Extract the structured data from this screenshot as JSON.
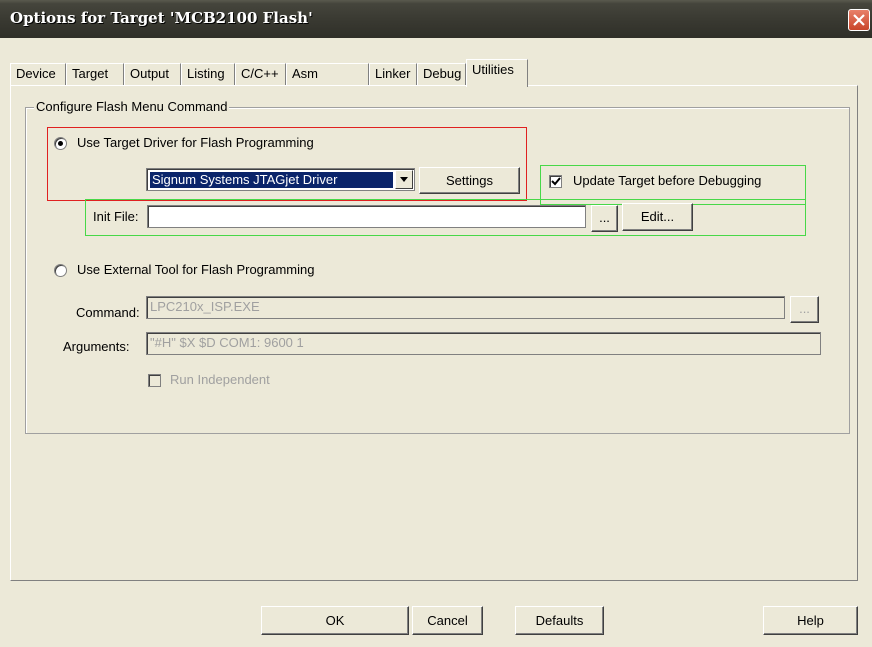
{
  "window": {
    "title": "Options for Target 'MCB2100 Flash'"
  },
  "tabs": [
    {
      "label": "Device"
    },
    {
      "label": "Target"
    },
    {
      "label": "Output"
    },
    {
      "label": "Listing"
    },
    {
      "label": "C/C++"
    },
    {
      "label": "Asm"
    },
    {
      "label": "Linker"
    },
    {
      "label": "Debug"
    },
    {
      "label": "Utilities",
      "active": true
    }
  ],
  "group": {
    "legend": "Configure Flash Menu Command",
    "use_target_driver": {
      "label": "Use Target Driver for Flash Programming",
      "selected": true
    },
    "driver_select": {
      "value": "Signum Systems JTAGjet Driver"
    },
    "settings_button": "Settings",
    "update_target": {
      "label": "Update Target before Debugging",
      "checked": true
    },
    "init_file": {
      "label": "Init File:",
      "value": "",
      "browse": "...",
      "edit": "Edit..."
    },
    "use_external_tool": {
      "label": "Use External Tool for Flash Programming",
      "selected": false
    },
    "command": {
      "label": "Command:",
      "value": "LPC210x_ISP.EXE",
      "browse": "..."
    },
    "arguments": {
      "label": "Arguments:",
      "value": "\"#H\" $X $D COM1: 9600 1"
    },
    "run_independent": {
      "label": "Run Independent",
      "checked": false
    }
  },
  "buttons": {
    "ok": "OK",
    "cancel": "Cancel",
    "defaults": "Defaults",
    "help": "Help"
  },
  "colors": {
    "highlight_red": "#e02020",
    "highlight_green": "#48d848",
    "selection": "#0a246a"
  }
}
